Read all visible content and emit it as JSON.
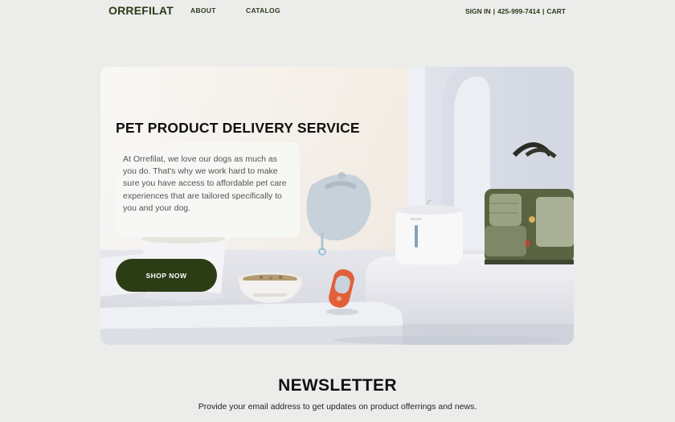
{
  "header": {
    "logo": "ORREFILAT",
    "nav": {
      "about": "ABOUT",
      "catalog": "CATALOG"
    },
    "utility": {
      "sign_in": "SIGN IN",
      "separator": "|",
      "phone": "425-999-7414",
      "cart": "CART"
    }
  },
  "hero": {
    "title": "PET PRODUCT DELIVERY SERVICE",
    "description": "At Orrefilat, we love our dogs as much as you do. That's why we work hard to make sure you have access to affordable pet care experiences that are tailored specifically to you and your dog.",
    "cta": "SHOP NOW",
    "water_fountain_brand": "PETKIT"
  },
  "newsletter": {
    "title": "NEWSLETTER",
    "subtitle": "Provide your email address to get updates on product offerrings and news."
  },
  "colors": {
    "brand_dark_green": "#2c3d16",
    "page_background": "#ecedeb",
    "accent_orange": "#e0603a",
    "carrier_green": "#5a6440"
  }
}
